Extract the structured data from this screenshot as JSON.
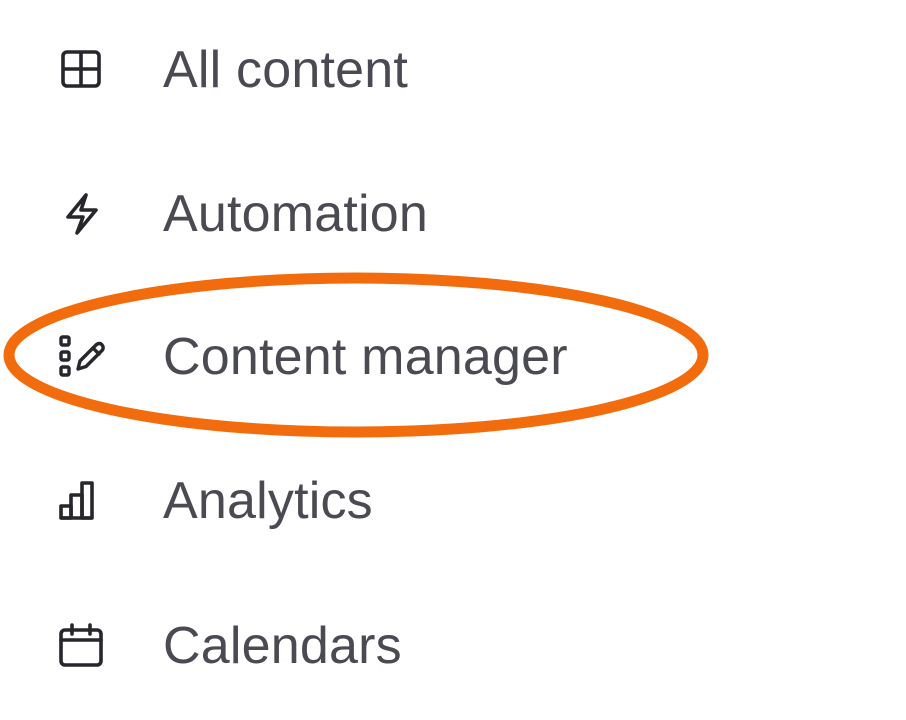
{
  "nav": {
    "items": [
      {
        "label": "All content",
        "icon": "grid-icon"
      },
      {
        "label": "Automation",
        "icon": "lightning-bolt-icon"
      },
      {
        "label": "Content manager",
        "icon": "list-pencil-icon",
        "highlighted": true
      },
      {
        "label": "Analytics",
        "icon": "bar-chart-icon"
      },
      {
        "label": "Calendars",
        "icon": "calendar-icon"
      }
    ]
  },
  "colors": {
    "text": "#4a4a52",
    "icon": "#26262c",
    "highlight_ring": "#f26c0d"
  }
}
